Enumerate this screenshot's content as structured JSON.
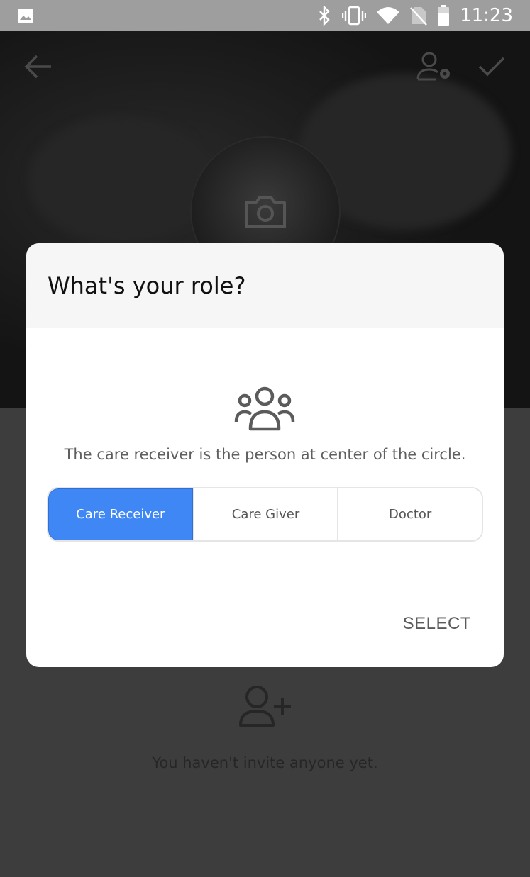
{
  "status_bar": {
    "time": "11:23",
    "icons": [
      "image-icon",
      "bluetooth-icon",
      "vibrate-icon",
      "wifi-icon",
      "no-sim-icon",
      "battery-icon"
    ]
  },
  "toolbar": {
    "back_icon": "arrow-left-icon",
    "manage_icon": "user-gear-icon",
    "confirm_icon": "check-icon"
  },
  "avatar": {
    "icon": "camera-icon"
  },
  "dialog": {
    "title": "What's your role?",
    "icon": "group-icon",
    "hint": "The care receiver is the person at center of the circle.",
    "roles": [
      "Care Receiver",
      "Care Giver",
      "Doctor"
    ],
    "selected_role": "Care Receiver",
    "select_label": "SELECT",
    "accent_color": "#3f87f5"
  },
  "empty_state": {
    "icon": "add-user-icon",
    "text": "You haven't invite anyone yet."
  }
}
